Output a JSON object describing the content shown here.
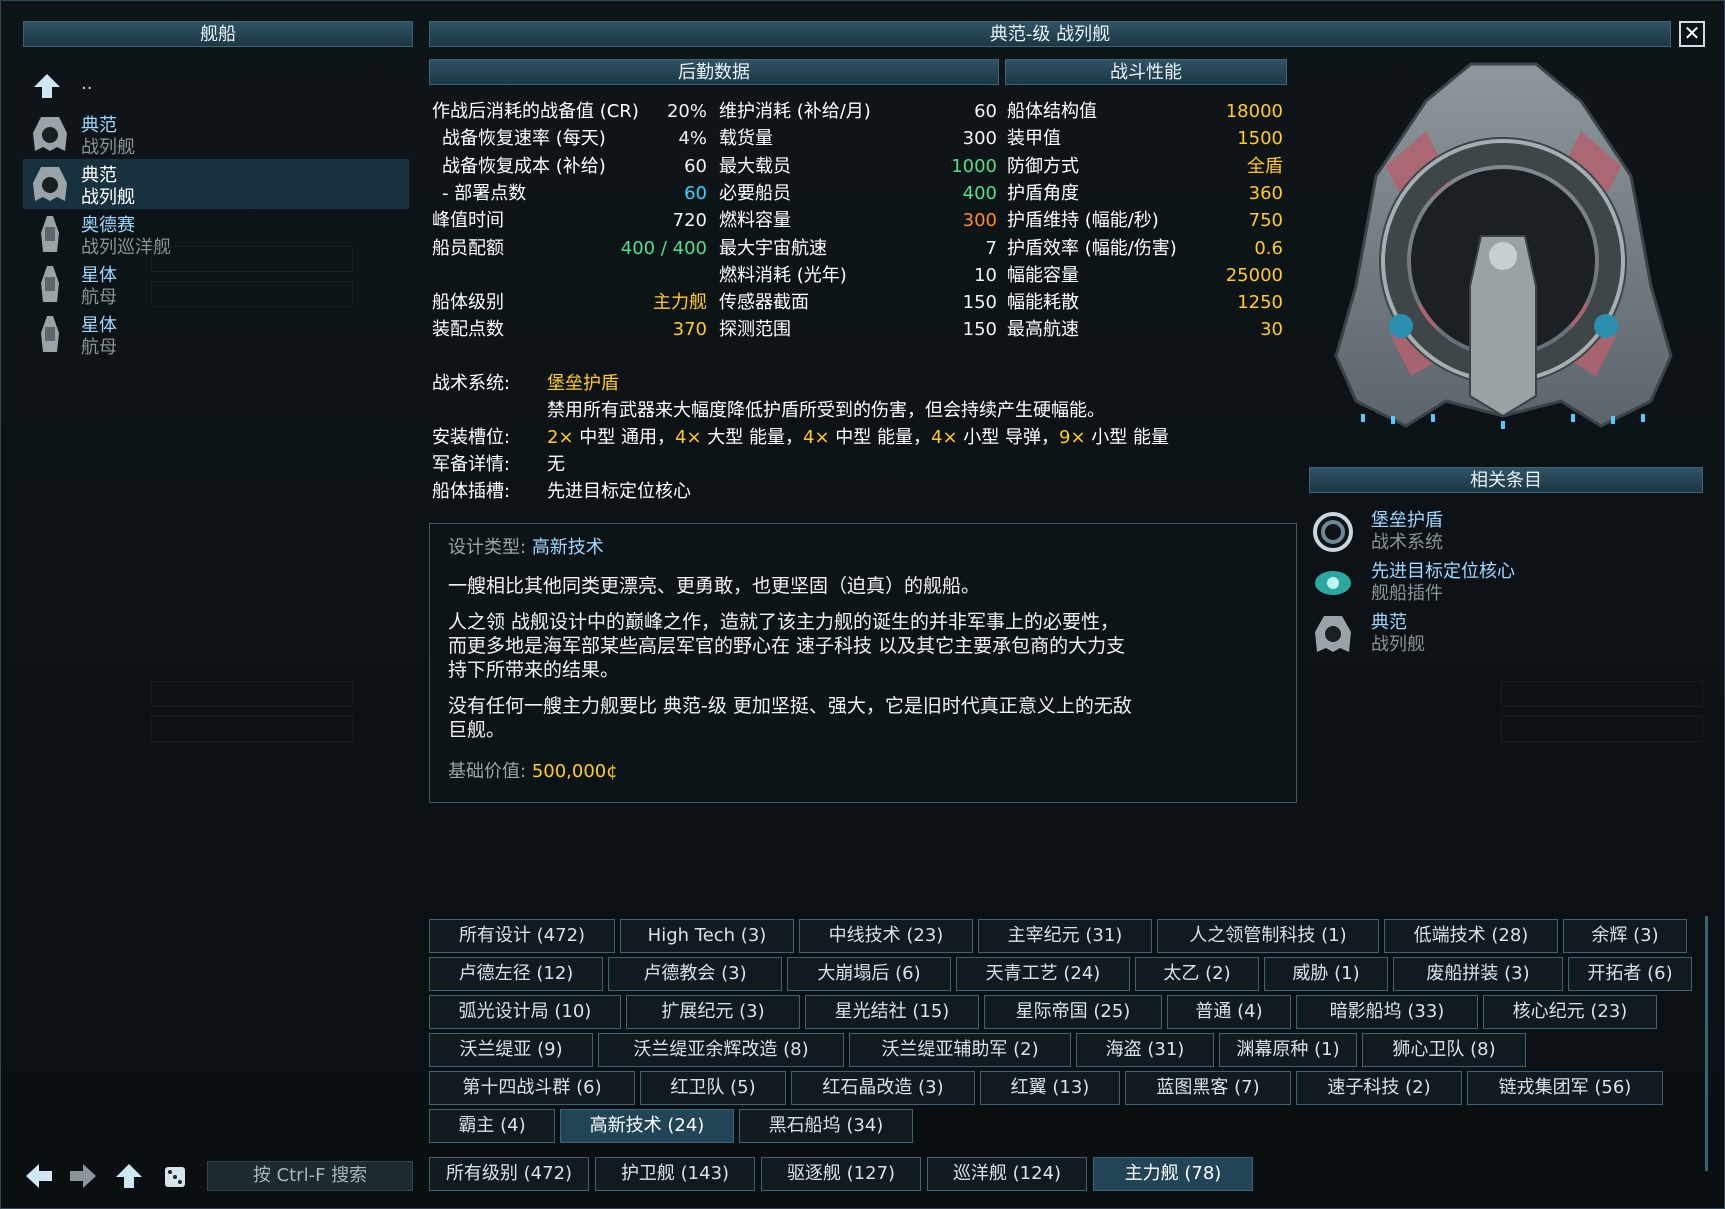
{
  "left_panel": {
    "title": "舰船",
    "up_label": "..",
    "items": [
      {
        "name": "典范",
        "type": "战列舰",
        "selected": false
      },
      {
        "name": "典范",
        "type": "战列舰",
        "selected": true
      },
      {
        "name": "奥德赛",
        "type": "战列巡洋舰",
        "selected": false
      },
      {
        "name": "星体",
        "type": "航母",
        "selected": false
      },
      {
        "name": "星体",
        "type": "航母",
        "selected": false
      }
    ],
    "search_label": "按 Ctrl-F 搜索"
  },
  "header": {
    "title": "典范-级 战列舰"
  },
  "logistics": {
    "title": "后勤数据",
    "rows": [
      {
        "label": "作战后消耗的战备值 (CR)",
        "value": "20%",
        "color": "w",
        "indent": false
      },
      {
        "label": "战备恢复速率 (每天)",
        "value": "4%",
        "color": "w",
        "indent": true
      },
      {
        "label": "战备恢复成本 (补给)",
        "value": "60",
        "color": "w",
        "indent": true
      },
      {
        "label": "- 部署点数",
        "value": "60",
        "color": "c",
        "indent": true
      },
      {
        "label": "峰值时间",
        "value": "720",
        "color": "w",
        "indent": false
      },
      {
        "label": "船员配额",
        "value": "400 / 400",
        "color": "g",
        "indent": false
      },
      {
        "label": "",
        "value": "",
        "color": "w",
        "indent": false
      },
      {
        "label": "船体级别",
        "value": "主力舰",
        "color": "y",
        "indent": false
      },
      {
        "label": "装配点数",
        "value": "370",
        "color": "y",
        "indent": false
      }
    ],
    "rows2": [
      {
        "label": "维护消耗 (补给/月)",
        "value": "60",
        "color": "w"
      },
      {
        "label": "载货量",
        "value": "300",
        "color": "w"
      },
      {
        "label": "最大载员",
        "value": "1000",
        "color": "g"
      },
      {
        "label": "必要船员",
        "value": "400",
        "color": "g"
      },
      {
        "label": "燃料容量",
        "value": "300",
        "color": "o"
      },
      {
        "label": "最大宇宙航速",
        "value": "7",
        "color": "w"
      },
      {
        "label": "燃料消耗 (光年)",
        "value": "10",
        "color": "w"
      },
      {
        "label": "传感器截面",
        "value": "150",
        "color": "w"
      },
      {
        "label": "探测范围",
        "value": "150",
        "color": "w"
      }
    ]
  },
  "combat": {
    "title": "战斗性能",
    "rows": [
      {
        "label": "船体结构值",
        "value": "18000",
        "color": "y"
      },
      {
        "label": "装甲值",
        "value": "1500",
        "color": "y"
      },
      {
        "label": "防御方式",
        "value": "全盾",
        "color": "y"
      },
      {
        "label": "护盾角度",
        "value": "360",
        "color": "y"
      },
      {
        "label": "护盾维持 (幅能/秒)",
        "value": "750",
        "color": "y"
      },
      {
        "label": "护盾效率 (幅能/伤害)",
        "value": "0.6",
        "color": "y"
      },
      {
        "label": "幅能容量",
        "value": "25000",
        "color": "y"
      },
      {
        "label": "幅能耗散",
        "value": "1250",
        "color": "y"
      },
      {
        "label": "最高航速",
        "value": "30",
        "color": "y"
      }
    ]
  },
  "systems": {
    "tactical_label": "战术系统:",
    "tactical_name": "堡垒护盾",
    "tactical_desc": "禁用所有武器来大幅度降低护盾所受到的伤害，但会持续产生硬幅能。",
    "mounts_label": "安装槽位:",
    "mounts": [
      {
        "count": "2×",
        "text": " 中型 通用，"
      },
      {
        "count": "4×",
        "text": " 大型 能量，"
      },
      {
        "count": "4×",
        "text": " 中型 能量，"
      },
      {
        "count": "4×",
        "text": " 小型 导弹，"
      },
      {
        "count": "9×",
        "text": " 小型 能量"
      }
    ],
    "armament_label": "军备详情:",
    "armament_value": "无",
    "hullmods_label": "船体插槽:",
    "hullmods_value": "先进目标定位核心"
  },
  "description": {
    "design_label": "设计类型:",
    "design_value": "高新技术",
    "p1": "一艘相比其他同类更漂亮、更勇敢，也更坚固（迫真）的舰船。",
    "p2a": "人之领 战舰设计中的巅峰之作，造就了该主力舰的诞生的并非军事上的必要性，",
    "p2b": "而更多地是海军部某些高层军官的野心在 速子科技 以及其它主要承包商的大力支",
    "p2c": "持下所带来的结果。",
    "p3a": "没有任何一艘主力舰要比 典范-级 更加坚挺、强大，它是旧时代真正意义上的无敌",
    "p3b": "巨舰。",
    "price_label": "基础价值:",
    "price_value": "500,000¢"
  },
  "related": {
    "title": "相关条目",
    "items": [
      {
        "name": "堡垒护盾",
        "type": "战术系统",
        "icon": "shield-ring-icon"
      },
      {
        "name": "先进目标定位核心",
        "type": "舰船插件",
        "icon": "targeting-core-icon"
      },
      {
        "name": "典范",
        "type": "战列舰",
        "icon": "ship-icon"
      }
    ]
  },
  "filters": {
    "rows": [
      [
        "所有设计 (472)",
        "High Tech (3)",
        "中线技术 (23)",
        "主宰纪元 (31)",
        "人之领管制科技 (1)",
        "低端技术 (28)",
        "余辉 (3)"
      ],
      [
        "卢德左径 (12)",
        "卢德教会 (3)",
        "大崩塌后 (6)",
        "天青工艺 (24)",
        "太乙 (2)",
        "威胁 (1)",
        "废船拼装 (3)",
        "开拓者 (6)"
      ],
      [
        "弧光设计局 (10)",
        "扩展纪元 (3)",
        "星光结社 (15)",
        "星际帝国 (25)",
        "普通 (4)",
        "暗影船坞 (33)",
        "核心纪元 (23)"
      ],
      [
        "沃兰缇亚 (9)",
        "沃兰缇亚余辉改造 (8)",
        "沃兰缇亚辅助军 (2)",
        "海盗 (31)",
        "渊幕原种 (1)",
        "狮心卫队 (8)"
      ],
      [
        "第十四战斗群 (6)",
        "红卫队 (5)",
        "红石晶改造 (3)",
        "红翼 (13)",
        "蓝图黑客 (7)",
        "速子科技 (2)",
        "链戎集团军 (56)"
      ],
      [
        "霸主 (4)",
        "高新技术 (24)",
        "黑石船坞 (34)"
      ]
    ],
    "active": "高新技术 (24)",
    "sizes": [
      "所有级别 (472)",
      "护卫舰 (143)",
      "驱逐舰 (127)",
      "巡洋舰 (124)",
      "主力舰 (78)"
    ],
    "active_size": "主力舰 (78)"
  },
  "colors": {
    "accent_yellow": "#ffcc21",
    "green": "#4fe08a",
    "cyan": "#2fd8ff",
    "orange": "#ff8a2b",
    "header_blue": "#2f5366"
  }
}
